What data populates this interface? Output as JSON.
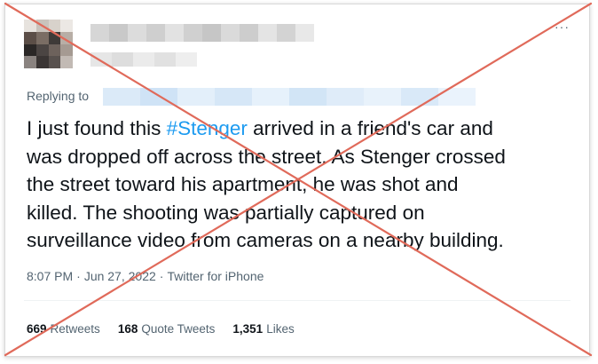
{
  "tweet": {
    "more_label": "···",
    "replying_label": "Replying to",
    "text_before": "I just found this ",
    "hashtag": "#Stenger",
    "text_line1_after": " arrived in a friend's car and",
    "text_lines": [
      "was dropped off across the street. As Stenger crossed",
      "the street toward his apartment, he was shot and",
      "killed. The shooting was partially captured on",
      "surveillance video from cameras on a nearby building."
    ],
    "time": "8:07 PM",
    "date": "Jun 27, 2022",
    "separator": "·",
    "source": "Twitter for iPhone",
    "stats": {
      "retweets_count": "669",
      "retweets_label": "Retweets",
      "quote_count": "168",
      "quote_label": "Quote Tweets",
      "likes_count": "1,351",
      "likes_label": "Likes"
    }
  },
  "colors": {
    "text": "#0f1419",
    "secondary": "#536471",
    "link": "#1d9bf0",
    "cross": "#e06a5a"
  }
}
